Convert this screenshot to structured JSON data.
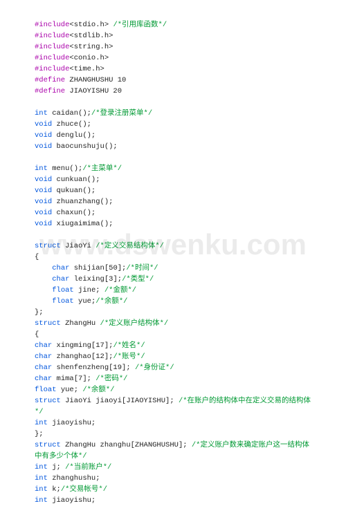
{
  "watermark": "www.dswenku.com",
  "code": {
    "lines": [
      [
        {
          "c": "purple",
          "t": "#include"
        },
        {
          "c": "black",
          "t": "<stdio.h> "
        },
        {
          "c": "green",
          "t": "/*引用库函数*/"
        }
      ],
      [
        {
          "c": "purple",
          "t": "#include"
        },
        {
          "c": "black",
          "t": "<stdlib.h>"
        }
      ],
      [
        {
          "c": "purple",
          "t": "#include"
        },
        {
          "c": "black",
          "t": "<string.h>"
        }
      ],
      [
        {
          "c": "purple",
          "t": "#include"
        },
        {
          "c": "black",
          "t": "<conio.h>"
        }
      ],
      [
        {
          "c": "purple",
          "t": "#include"
        },
        {
          "c": "black",
          "t": "<time.h>"
        }
      ],
      [
        {
          "c": "purple",
          "t": "#define"
        },
        {
          "c": "black",
          "t": " ZHANGHUSHU 10"
        }
      ],
      [
        {
          "c": "purple",
          "t": "#define"
        },
        {
          "c": "black",
          "t": " JIAOYISHU 20"
        }
      ],
      [
        {
          "c": "black",
          "t": ""
        }
      ],
      [
        {
          "c": "blue",
          "t": "int"
        },
        {
          "c": "black",
          "t": " caidan();"
        },
        {
          "c": "green",
          "t": "/*登录注册菜单*/"
        }
      ],
      [
        {
          "c": "blue",
          "t": "void"
        },
        {
          "c": "black",
          "t": " zhuce();"
        }
      ],
      [
        {
          "c": "blue",
          "t": "void"
        },
        {
          "c": "black",
          "t": " denglu();"
        }
      ],
      [
        {
          "c": "blue",
          "t": "void"
        },
        {
          "c": "black",
          "t": " baocunshuju();"
        }
      ],
      [
        {
          "c": "black",
          "t": ""
        }
      ],
      [
        {
          "c": "blue",
          "t": "int"
        },
        {
          "c": "black",
          "t": " menu();"
        },
        {
          "c": "green",
          "t": "/*主菜单*/"
        }
      ],
      [
        {
          "c": "blue",
          "t": "void"
        },
        {
          "c": "black",
          "t": " cunkuan();"
        }
      ],
      [
        {
          "c": "blue",
          "t": "void"
        },
        {
          "c": "black",
          "t": " qukuan();"
        }
      ],
      [
        {
          "c": "blue",
          "t": "void"
        },
        {
          "c": "black",
          "t": " zhuanzhang();"
        }
      ],
      [
        {
          "c": "blue",
          "t": "void"
        },
        {
          "c": "black",
          "t": " chaxun();"
        }
      ],
      [
        {
          "c": "blue",
          "t": "void"
        },
        {
          "c": "black",
          "t": " xiugaimima();"
        }
      ],
      [
        {
          "c": "black",
          "t": ""
        }
      ],
      [
        {
          "c": "blue",
          "t": "struct"
        },
        {
          "c": "black",
          "t": " JiaoYi "
        },
        {
          "c": "green",
          "t": "/*定义交易结构体*/"
        }
      ],
      [
        {
          "c": "black",
          "t": "{"
        }
      ],
      [
        {
          "c": "black",
          "t": "    "
        },
        {
          "c": "blue",
          "t": "char"
        },
        {
          "c": "black",
          "t": " shijian[50];"
        },
        {
          "c": "green",
          "t": "/*时间*/"
        }
      ],
      [
        {
          "c": "black",
          "t": "    "
        },
        {
          "c": "blue",
          "t": "char"
        },
        {
          "c": "black",
          "t": " leixing[3];"
        },
        {
          "c": "green",
          "t": "/*类型*/"
        }
      ],
      [
        {
          "c": "black",
          "t": "    "
        },
        {
          "c": "blue",
          "t": "float"
        },
        {
          "c": "black",
          "t": " jine; "
        },
        {
          "c": "green",
          "t": "/*金额*/"
        }
      ],
      [
        {
          "c": "black",
          "t": "    "
        },
        {
          "c": "blue",
          "t": "float"
        },
        {
          "c": "black",
          "t": " yue;"
        },
        {
          "c": "green",
          "t": "/*余额*/"
        }
      ],
      [
        {
          "c": "black",
          "t": "};"
        }
      ],
      [
        {
          "c": "blue",
          "t": "struct"
        },
        {
          "c": "black",
          "t": " ZhangHu "
        },
        {
          "c": "green",
          "t": "/*定义账户结构体*/"
        }
      ],
      [
        {
          "c": "black",
          "t": "{"
        }
      ],
      [
        {
          "c": "blue",
          "t": "char"
        },
        {
          "c": "black",
          "t": " xingming[17];"
        },
        {
          "c": "green",
          "t": "/*姓名*/"
        }
      ],
      [
        {
          "c": "blue",
          "t": "char"
        },
        {
          "c": "black",
          "t": " zhanghao[12];"
        },
        {
          "c": "green",
          "t": "/*账号*/"
        }
      ],
      [
        {
          "c": "blue",
          "t": "char"
        },
        {
          "c": "black",
          "t": " shenfenzheng[19]; "
        },
        {
          "c": "green",
          "t": "/*身份证*/"
        }
      ],
      [
        {
          "c": "blue",
          "t": "char"
        },
        {
          "c": "black",
          "t": " mima[7]; "
        },
        {
          "c": "green",
          "t": "/*密码*/"
        }
      ],
      [
        {
          "c": "blue",
          "t": "float"
        },
        {
          "c": "black",
          "t": " yue; "
        },
        {
          "c": "green",
          "t": "/*余额*/"
        }
      ],
      [
        {
          "c": "blue",
          "t": "struct"
        },
        {
          "c": "black",
          "t": " JiaoYi jiaoyi[JIAOYISHU]; "
        },
        {
          "c": "green",
          "t": "/*在账户的结构体中在定义交易的结构体"
        }
      ],
      [
        {
          "c": "green",
          "t": "*/"
        }
      ],
      [
        {
          "c": "blue",
          "t": "int"
        },
        {
          "c": "black",
          "t": " jiaoyishu;"
        }
      ],
      [
        {
          "c": "black",
          "t": "};"
        }
      ],
      [
        {
          "c": "blue",
          "t": "struct"
        },
        {
          "c": "black",
          "t": " ZhangHu zhanghu[ZHANGHUSHU]; "
        },
        {
          "c": "green",
          "t": "/*定义账户数来确定账户这一结构体"
        }
      ],
      [
        {
          "c": "green",
          "t": "中有多少个体*/"
        }
      ],
      [
        {
          "c": "blue",
          "t": "int"
        },
        {
          "c": "black",
          "t": " j; "
        },
        {
          "c": "green",
          "t": "/*当前账户*/"
        }
      ],
      [
        {
          "c": "blue",
          "t": "int"
        },
        {
          "c": "black",
          "t": " zhanghushu;"
        }
      ],
      [
        {
          "c": "blue",
          "t": "int"
        },
        {
          "c": "black",
          "t": " k;"
        },
        {
          "c": "green",
          "t": "/*交易帐号*/"
        }
      ],
      [
        {
          "c": "blue",
          "t": "int"
        },
        {
          "c": "black",
          "t": " jiaoyishu;"
        }
      ]
    ]
  }
}
